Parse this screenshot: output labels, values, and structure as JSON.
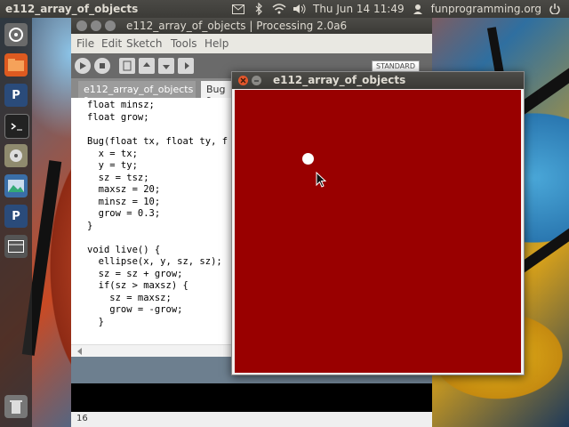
{
  "top_panel": {
    "app_title": "e112_array_of_objects",
    "clock": "Thu Jun 14 11:49",
    "user": "funprogramming.org",
    "icons": [
      "mail-icon",
      "bluetooth-icon",
      "wifi-icon",
      "volume-icon",
      "power-icon"
    ]
  },
  "launcher": {
    "items": [
      "dash-icon",
      "files-icon",
      "processing-icon",
      "terminal-icon",
      "disk-icon",
      "image-viewer-icon",
      "processing-icon",
      "workspace-icon",
      "trash-icon"
    ]
  },
  "editor": {
    "title": "e112_array_of_objects | Processing 2.0a6",
    "menu": [
      "File",
      "Edit",
      "Sketch",
      "Tools",
      "Help"
    ],
    "mode": "STANDARD",
    "tabs": [
      "e112_array_of_objects §",
      "Bug §"
    ],
    "code_lines": [
      "float minsz;",
      "float grow;",
      "",
      "Bug(float tx, float ty, f",
      "  x = tx;",
      "  y = ty;",
      "  sz = tsz;",
      "  maxsz = 20;",
      "  minsz = 10;",
      "  grow = 0.3;",
      "}",
      "",
      "void live() {",
      "  ellipse(x, y, sz, sz);",
      "  sz = sz + grow;",
      "  if(sz > maxsz) {",
      "    sz = maxsz;",
      "    grow = -grow;",
      "  }"
    ],
    "line_number": "16"
  },
  "sketch": {
    "title": "e112_array_of_objects",
    "background_color": "#990000",
    "ball_color": "#ffffff"
  }
}
